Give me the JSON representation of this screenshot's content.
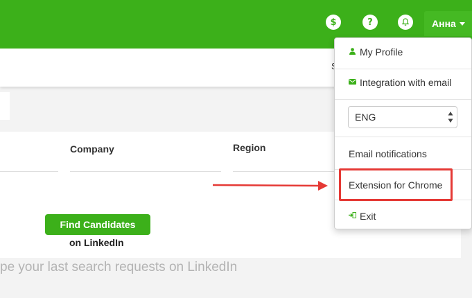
{
  "header": {
    "icons": [
      "dollar-icon",
      "question-icon",
      "bell-icon"
    ],
    "dollar_glyph": "$",
    "question_glyph": "?",
    "user_name": "Анна"
  },
  "subbar": {
    "fragment": "S"
  },
  "search_form": {
    "company_label": "Company",
    "region_label": "Region",
    "find_button": "Find Candidates",
    "find_button_sub": "on LinkedIn"
  },
  "hint_text": "pe your last search requests on LinkedIn",
  "dropdown": {
    "my_profile": "My Profile",
    "integration_email": "Integration with email",
    "language_selected": "ENG",
    "email_notifications": "Email notifications",
    "extension_chrome": "Extension for Chrome",
    "exit": "Exit"
  },
  "colors": {
    "brand_green": "#3cb01a",
    "annotation_red": "#e53935"
  }
}
